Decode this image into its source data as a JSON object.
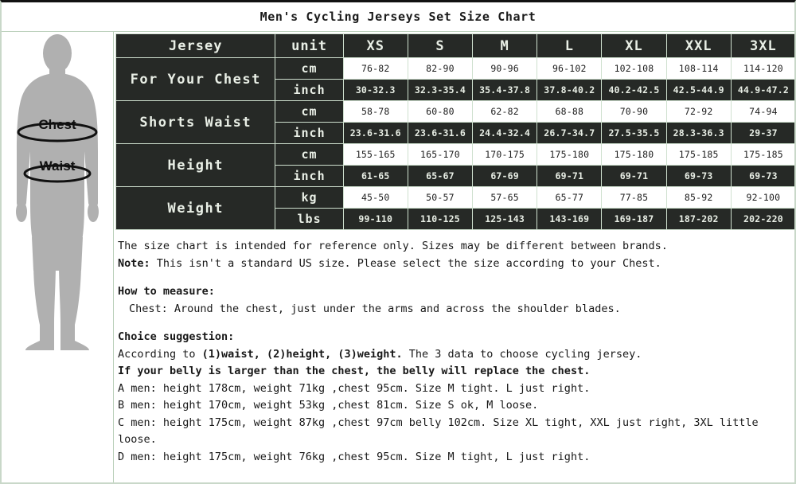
{
  "page": {
    "title": "Men's Cycling Jerseys Set Size Chart"
  },
  "figure": {
    "chest_label": "Chest",
    "waist_label": "Waist"
  },
  "chart_data": {
    "type": "table",
    "title": "Men's Cycling Jerseys Set Size Chart",
    "columns": [
      "Jersey",
      "unit",
      "XS",
      "S",
      "M",
      "L",
      "XL",
      "XXL",
      "3XL"
    ],
    "sizes": [
      "XS",
      "S",
      "M",
      "L",
      "XL",
      "XXL",
      "3XL"
    ],
    "header": {
      "label": "Jersey",
      "unit": "unit",
      "xs": "XS",
      "s": "S",
      "m": "M",
      "l": "L",
      "xl": "XL",
      "xxl": "XXL",
      "xxxl": "3XL"
    },
    "rows": [
      {
        "label": "For Your Chest",
        "units": [
          {
            "unit": "cm",
            "values": [
              "76-82",
              "82-90",
              "90-96",
              "96-102",
              "102-108",
              "108-114",
              "114-120"
            ]
          },
          {
            "unit": "inch",
            "values": [
              "30-32.3",
              "32.3-35.4",
              "35.4-37.8",
              "37.8-40.2",
              "40.2-42.5",
              "42.5-44.9",
              "44.9-47.2"
            ]
          }
        ]
      },
      {
        "label": "Shorts Waist",
        "units": [
          {
            "unit": "cm",
            "values": [
              "58-78",
              "60-80",
              "62-82",
              "68-88",
              "70-90",
              "72-92",
              "74-94"
            ]
          },
          {
            "unit": "inch",
            "values": [
              "23.6-31.6",
              "23.6-31.6",
              "24.4-32.4",
              "26.7-34.7",
              "27.5-35.5",
              "28.3-36.3",
              "29-37"
            ]
          }
        ]
      },
      {
        "label": "Height",
        "units": [
          {
            "unit": "cm",
            "values": [
              "155-165",
              "165-170",
              "170-175",
              "175-180",
              "175-180",
              "175-185",
              "175-185"
            ]
          },
          {
            "unit": "inch",
            "values": [
              "61-65",
              "65-67",
              "67-69",
              "69-71",
              "69-71",
              "69-73",
              "69-73"
            ]
          }
        ]
      },
      {
        "label": "Weight",
        "units": [
          {
            "unit": "kg",
            "values": [
              "45-50",
              "50-57",
              "57-65",
              "65-77",
              "77-85",
              "85-92",
              "92-100"
            ]
          },
          {
            "unit": "lbs",
            "values": [
              "99-110",
              "110-125",
              "125-143",
              "143-169",
              "169-187",
              "187-202",
              "202-220"
            ]
          }
        ]
      }
    ]
  },
  "notes": {
    "disclaimer": "The size chart is intended for reference only. Sizes may be different between brands.",
    "note_prefix": "Note:",
    "note_body": " This isn't a standard US size. Please select the size according to your Chest.",
    "how_to_measure_heading": "How to measure:",
    "how_to_measure_chest": "Chest: Around the chest, just under the arms and across the shoulder blades.",
    "choice_heading": "Choice suggestion:",
    "choice_line_prefix": "According to ",
    "choice_line_bold": "(1)waist, (2)height, (3)weight.",
    "choice_line_suffix": " The 3 data to choose cycling jersey.",
    "belly_line": "If your belly is larger than the chest, the belly will replace the chest.",
    "example_a": "A men: height 178cm, weight 71kg ,chest 95cm. Size M tight. L just right.",
    "example_b": "B men: height 170cm, weight 53kg ,chest 81cm. Size S ok, M loose.",
    "example_c": "C men: height 175cm, weight 87kg ,chest 97cm belly 102cm. Size XL tight, XXL just right, 3XL little loose.",
    "example_d": "D men: height 175cm, weight 76kg ,chest 95cm. Size M tight, L just right."
  },
  "colors": {
    "dark_cell": "#262926",
    "light_cell": "#ffffff",
    "cell_border": "#cfe0cf",
    "frame": "#c9d8c9",
    "silhouette": "#b0b0b0",
    "text_dark": "#1d1d1d",
    "text_light": "#e9efe6"
  }
}
